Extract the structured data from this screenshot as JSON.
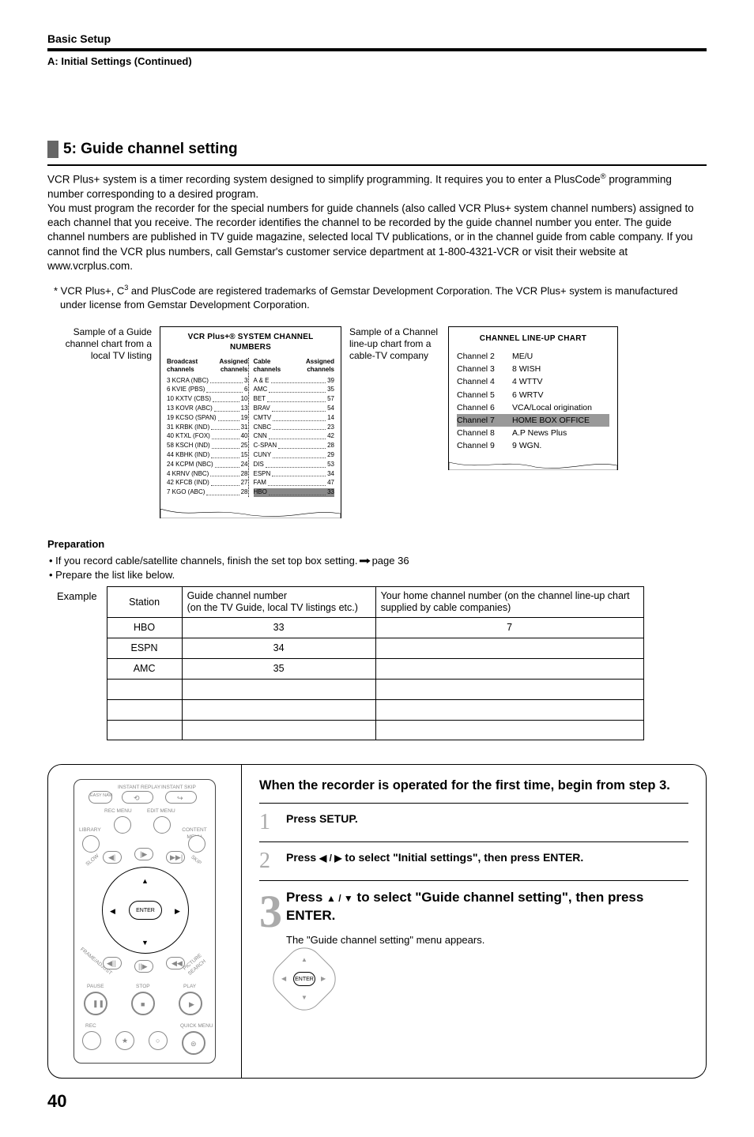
{
  "header": {
    "breadcrumb": "Basic Setup",
    "continued": "A: Initial Settings (Continued)"
  },
  "section": {
    "title": "5: Guide channel setting",
    "para1a": "VCR Plus+ system is a timer recording system designed to simplify programming. It requires you to enter a PlusCode",
    "para1b": " programming number corresponding to a desired program.",
    "para2": "You must program the recorder for the special numbers for guide channels (also called VCR Plus+ system channel numbers) assigned to each channel that you receive. The recorder identifies the channel to be recorded by the guide channel number you enter. The guide channel numbers are published in TV guide magazine, selected local TV publications, or in the channel guide from cable company. If you cannot find the VCR plus numbers, call Gemstar's customer service department at 1-800-4321-VCR or visit their website at www.vcrplus.com.",
    "footnote_a": "* VCR Plus+, C",
    "footnote_b": " and PlusCode are registered trademarks of Gemstar Development Corporation. The VCR Plus+ system is manufactured under license from Gemstar Development Corporation."
  },
  "sample1": {
    "caption": "Sample of a Guide channel chart from a local TV listing",
    "title": "VCR Plus+® SYSTEM CHANNEL NUMBERS",
    "col1_head_l": "Broadcast channels",
    "col1_head_r": "Assigned channels",
    "col2_head_l": "Cable channels",
    "col2_head_r": "Assigned channels",
    "col1": [
      {
        "l": "3  KCRA (NBC)",
        "r": "3"
      },
      {
        "l": "6  KVIE (PBS)",
        "r": "6"
      },
      {
        "l": "10  KXTV (CBS)",
        "r": "10"
      },
      {
        "l": "13  KOVR (ABC)",
        "r": "13"
      },
      {
        "l": "19  KCSO (SPAN)",
        "r": "19"
      },
      {
        "l": "31  KRBK (IND)",
        "r": "31"
      },
      {
        "l": "40  KTXL (FOX)",
        "r": "40"
      },
      {
        "l": "58  KSCH (IND)",
        "r": "25"
      },
      {
        "l": "44  KBHK (IND)",
        "r": "15"
      },
      {
        "l": "24  KCPM (NBC)",
        "r": "24"
      },
      {
        "l": "4  KRNV (NBC)",
        "r": "28"
      },
      {
        "l": "42  KFCB (IND)",
        "r": "27"
      },
      {
        "l": "7  KGO (ABC)",
        "r": "28"
      }
    ],
    "col2": [
      {
        "l": "A & E",
        "r": "39"
      },
      {
        "l": "AMC",
        "r": "35"
      },
      {
        "l": "BET",
        "r": "57"
      },
      {
        "l": "BRAV",
        "r": "54"
      },
      {
        "l": "CMTV",
        "r": "14"
      },
      {
        "l": "CNBC",
        "r": "23"
      },
      {
        "l": "CNN",
        "r": "42"
      },
      {
        "l": "C-SPAN",
        "r": "28"
      },
      {
        "l": "CUNY",
        "r": "29"
      },
      {
        "l": "DIS",
        "r": "53"
      },
      {
        "l": "ESPN",
        "r": "34"
      },
      {
        "l": "FAM",
        "r": "47"
      },
      {
        "l": "HBO",
        "r": "33",
        "hi": true
      }
    ]
  },
  "sample2": {
    "caption": "Sample of a Channel line-up chart from a cable-TV company",
    "title": "CHANNEL LINE-UP CHART",
    "rows": [
      {
        "l": "Channel 2",
        "r": "ME/U"
      },
      {
        "l": "Channel 3",
        "r": "8 WISH"
      },
      {
        "l": "Channel 4",
        "r": "4 WTTV"
      },
      {
        "l": "Channel 5",
        "r": "6 WRTV"
      },
      {
        "l": "Channel 6",
        "r": "VCA/Local origination"
      },
      {
        "l": "Channel 7",
        "r": "HOME BOX OFFICE",
        "hi": true
      },
      {
        "l": "Channel 8",
        "r": "A.P News Plus"
      },
      {
        "l": "Channel 9",
        "r": "9 WGN."
      }
    ]
  },
  "prep": {
    "title": "Preparation",
    "b1_a": "• If you record cable/satellite channels, finish the set top box setting.  ",
    "b1_b": " page 36",
    "b2": "• Prepare the list like below."
  },
  "example": {
    "label": "Example",
    "headers": [
      "Station",
      "Guide channel number\n(on the TV Guide, local TV listings etc.)",
      "Your home channel number (on the channel line-up chart supplied by cable companies)"
    ],
    "rows": [
      [
        "HBO",
        "33",
        "7"
      ],
      [
        "ESPN",
        "34",
        ""
      ],
      [
        "AMC",
        "35",
        ""
      ],
      [
        "",
        "",
        ""
      ],
      [
        "",
        "",
        ""
      ],
      [
        "",
        "",
        ""
      ]
    ]
  },
  "remote": {
    "instant_replay": "INSTANT REPLAY",
    "instant_skip": "INSTANT SKIP",
    "easy_navi": "EASY NAVI",
    "rec_menu": "REC MENU",
    "edit_menu": "EDIT MENU",
    "library": "LIBRARY",
    "content_menu": "CONTENT MENU",
    "slow": "SLOW",
    "skip": "SKIP",
    "enter": "ENTER",
    "frame_adj": "FRAME/ADJUST",
    "picture_search": "PICTURE SEARCH",
    "pause": "PAUSE",
    "stop": "STOP",
    "play": "PLAY",
    "rec": "REC",
    "quick_menu": "QUICK MENU"
  },
  "steps": {
    "lead": "When the recorder is operated for the first time, begin from step 3.",
    "s1_num": "1",
    "s1_txt": "Press SETUP.",
    "s2_num": "2",
    "s2_txt_a": "Press ",
    "s2_txt_b": " to select \"Initial settings\", then press ENTER.",
    "s3_num": "3",
    "s3_txt_a": "Press ",
    "s3_txt_b": " to select \"Guide channel setting\", then press ENTER.",
    "s3_sub": "The \"Guide channel setting\" menu appears.",
    "enter": "ENTER"
  },
  "page_number": "40"
}
